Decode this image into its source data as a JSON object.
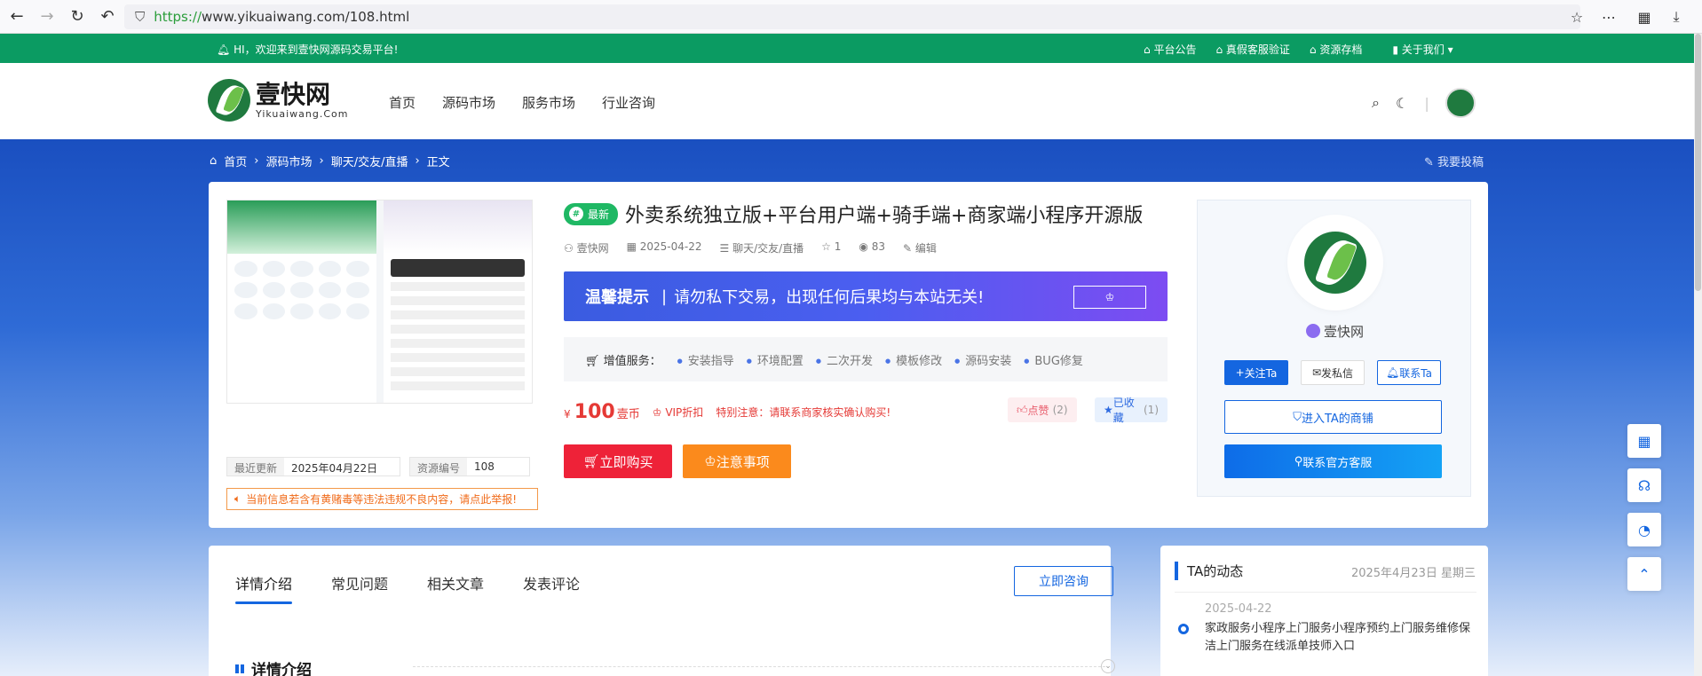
{
  "browser": {
    "url_scheme": "https://",
    "url_rest": "www.yikuaiwang.com/108.html"
  },
  "topbar": {
    "welcome": "HI，欢迎来到壹快网源码交易平台!",
    "links": [
      "平台公告",
      "真假客服验证",
      "资源存档",
      "关于我们"
    ]
  },
  "header": {
    "logo_cn": "壹快网",
    "logo_en": "Yikuaiwang.Com",
    "nav": [
      "首页",
      "源码市场",
      "服务市场",
      "行业咨询"
    ]
  },
  "breadcrumb": [
    "首页",
    "源码市场",
    "聊天/交友/直播",
    "正文"
  ],
  "contribute": "我要投稿",
  "product": {
    "tag": "最新",
    "title": "外卖系统独立版+平台用户端+骑手端+商家端小程序开源版",
    "author": "壹快网",
    "date": "2025-04-22",
    "category": "聊天/交友/直播",
    "likes_meta": "1",
    "views": "83",
    "edit": "编辑",
    "banner_bold": "温馨提示",
    "banner_text": "请勿私下交易，出现任何后果均与本站无关!",
    "services_head": "增值服务：",
    "services": [
      "安装指导",
      "环境配置",
      "二次开发",
      "模板修改",
      "源码安装",
      "BUG修复"
    ],
    "price_currency": "¥",
    "price": "100",
    "price_unit": "壹币",
    "vip": "VIP折扣",
    "notice": "特别注意：请联系商家核实确认购买!",
    "like_label": "点赞",
    "like_count": "(2)",
    "fav_label": "已收藏",
    "fav_count": "(1)",
    "buy_label": "立即购买",
    "notice_label": "注意事项",
    "updated_key": "最近更新",
    "updated_val": "2025年04月22日",
    "id_key": "资源编号",
    "id_val": "108",
    "report": "当前信息若含有黄赌毒等违法违规不良内容，请点此举报!"
  },
  "seller": {
    "name": "壹快网",
    "follow": "关注Ta",
    "message": "发私信",
    "contact": "联系Ta",
    "shop": "进入TA的商铺",
    "service": "联系官方客服"
  },
  "detail": {
    "tabs": [
      "详情介绍",
      "常见问题",
      "相关文章",
      "发表评论"
    ],
    "consult": "立即咨询",
    "section_title": "详情介绍"
  },
  "activity": {
    "title": "TA的动态",
    "today": "2025年4月23日 星期三",
    "item_date": "2025-04-22",
    "item_text": "家政服务小程序上门服务小程序预约上门服务维修保洁上门服务在线派单技师入口"
  }
}
